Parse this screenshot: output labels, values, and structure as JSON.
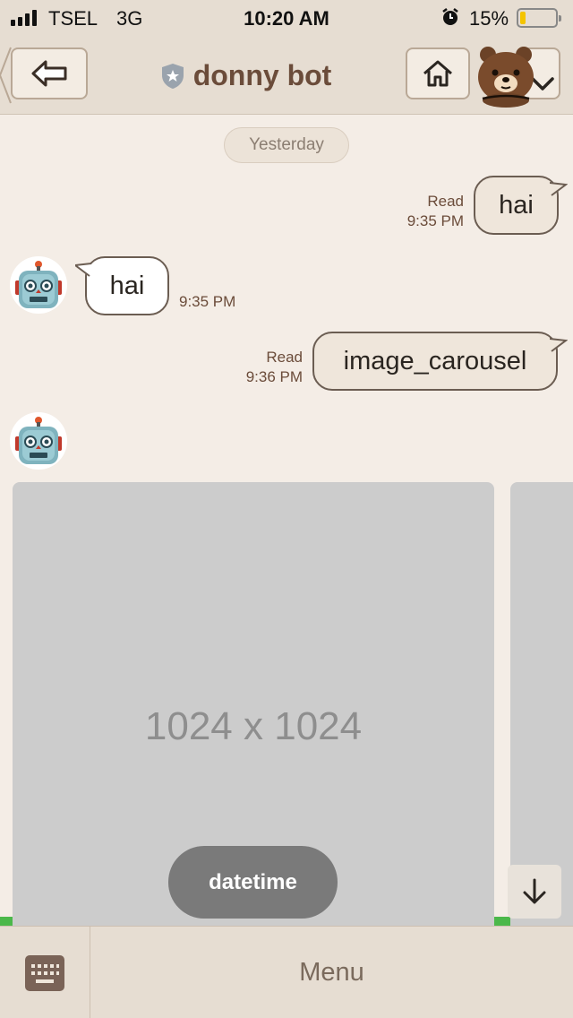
{
  "status_bar": {
    "carrier": "TSEL",
    "network": "3G",
    "time": "10:20 AM",
    "battery_percent": "15%",
    "battery_level": 0.15,
    "battery_color": "#f4c400"
  },
  "header": {
    "title": "donny bot",
    "back_icon": "back-arrow-icon",
    "home_icon": "home-icon",
    "verified_icon": "shield-star-icon",
    "profile_icon": "bear-avatar-icon",
    "dropdown_icon": "chevron-down-icon"
  },
  "chat": {
    "date_separator": "Yesterday",
    "messages": [
      {
        "direction": "outgoing",
        "text": "hai",
        "read_label": "Read",
        "time": "9:35 PM"
      },
      {
        "direction": "incoming",
        "text": "hai",
        "time": "9:35 PM",
        "avatar_icon": "robot-icon"
      },
      {
        "direction": "outgoing",
        "text": "image_carousel",
        "read_label": "Read",
        "time": "9:36 PM"
      },
      {
        "direction": "incoming",
        "type": "image_carousel",
        "avatar_icon": "robot-icon",
        "image_label": "1024 x 1024",
        "action_label": "datetime"
      }
    ],
    "scroll_down_icon": "arrow-down-icon"
  },
  "bottom_bar": {
    "keyboard_icon": "keyboard-icon",
    "menu_label": "Menu"
  },
  "colors": {
    "background": "#f4ede6",
    "bar": "#e6ddd2",
    "title_brown": "#6b4c3a",
    "accent_green": "#4bb84a"
  }
}
